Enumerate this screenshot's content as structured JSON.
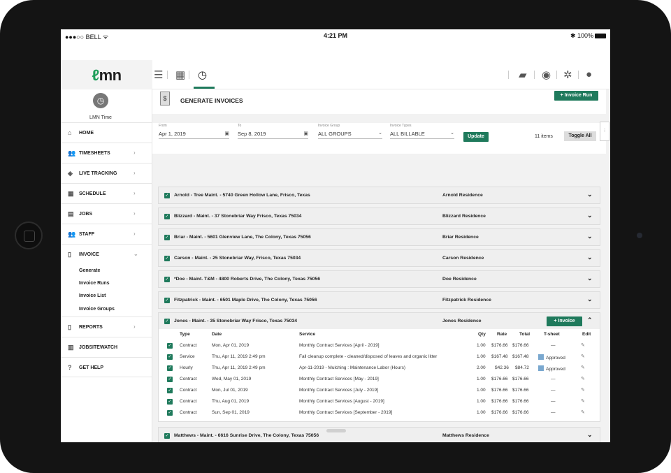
{
  "status_bar": {
    "carrier": "●●●○○ BELL ᯤ",
    "time": "4:21 PM",
    "battery": "✱ 100%"
  },
  "brand": {
    "logo_prefix": "ℓ",
    "logo_text": "mn",
    "accent": "#1f7a5c",
    "logo_accent": "#1e9e5a"
  },
  "topnav": {
    "icons": [
      "menu-icon",
      "calculator-icon",
      "clock-icon",
      "chat-icon",
      "globe-icon",
      "gear-icon",
      "user-icon"
    ]
  },
  "sidebar": {
    "title": "LMN Time",
    "items": [
      {
        "label": "HOME",
        "icon": "⌂",
        "chevron": ""
      },
      {
        "label": "TIMESHEETS",
        "icon": "👥",
        "chevron": "›"
      },
      {
        "label": "LIVE TRACKING",
        "icon": "◈",
        "chevron": "›"
      },
      {
        "label": "SCHEDULE",
        "icon": "▦",
        "chevron": "›"
      },
      {
        "label": "JOBS",
        "icon": "▤",
        "chevron": "›"
      },
      {
        "label": "STAFF",
        "icon": "👥",
        "chevron": "›"
      },
      {
        "label": "INVOICE",
        "icon": "▯",
        "chevron": "⌄"
      },
      {
        "label": "REPORTS",
        "icon": "▯",
        "chevron": "›"
      },
      {
        "label": "JOBSITEWATCH",
        "icon": "▥",
        "chevron": ""
      },
      {
        "label": "GET HELP",
        "icon": "?",
        "chevron": ""
      }
    ],
    "invoice_sub": [
      "Generate",
      "Invoice Runs",
      "Invoice List",
      "Invoice Groups"
    ]
  },
  "header": {
    "title": "GENERATE INVOICES",
    "run_button": "+ Invoice Run",
    "doc_icon": "$"
  },
  "filters": {
    "from_label": "From",
    "from_value": "Apr 1, 2019",
    "to_label": "To",
    "to_value": "Sep 8, 2019",
    "group_label": "Invoice Group",
    "group_value": "ALL GROUPS",
    "types_label": "Invoice Types",
    "types_value": "ALL BILLABLE",
    "update_button": "Update",
    "items_count": "11 items",
    "toggle_button": "Toggle All"
  },
  "invoice_rows": [
    {
      "address": "Arnold - Tree Maint. - 5740 Green Hollow Lane, Frisco, Texas",
      "name": "Arnold Residence"
    },
    {
      "address": "Blizzard - Maint. - 37 Stonebriar Way Frisco, Texas 75034",
      "name": "Blizzard Residence"
    },
    {
      "address": "Briar - Maint. - 5601 Glenview Lane, The Colony, Texas 75056",
      "name": "Briar Residence"
    },
    {
      "address": "Carson - Maint. - 25 Stonebriar Way, Frisco, Texas 75034",
      "name": "Carson Residence"
    },
    {
      "address": "*Doe - Maint. T&M - 4800 Roberts Drive, The Colony, Texas 75056",
      "name": "Doe Residence"
    },
    {
      "address": "Fitzpatrick - Maint. - 6501 Maple Drive, The Colony, Texas 75056",
      "name": "Fitzpatrick Residence"
    },
    {
      "address": "Jones - Maint. - 35 Stonebriar Way Frisco, Texas 75034",
      "name": "Jones Residence"
    },
    {
      "address": "Matthews - Maint. - 6616 Sunrise Drive, The Colony, Texas 75056",
      "name": "Matthews Residence"
    }
  ],
  "expanded": {
    "invoice_button": "+ Invoice",
    "columns": {
      "type": "Type",
      "date": "Date",
      "service": "Service",
      "qty": "Qty",
      "rate": "Rate",
      "total": "Total",
      "tsheet": "T-sheet",
      "edit": "Edit"
    },
    "lines": [
      {
        "type": "Contract",
        "date": "Mon, Apr 01, 2019",
        "service": "Monthly Contract Services [April - 2019]",
        "qty": "1.00",
        "rate": "$176.66",
        "total": "$176.66",
        "tsheet": "—"
      },
      {
        "type": "Service",
        "date": "Thu, Apr 11, 2019 2:49 pm",
        "service": "Fall cleanup complete - cleaned/disposed of leaves and organic litter",
        "qty": "1.00",
        "rate": "$167.48",
        "total": "$167.48",
        "tsheet": "Approved"
      },
      {
        "type": "Hourly",
        "date": "Thu, Apr 11, 2019 2:49 pm",
        "service": "Apr-11-2019 - Mulching : Maintenance Labor (Hours)",
        "qty": "2.00",
        "rate": "$42.36",
        "total": "$84.72",
        "tsheet": "Approved"
      },
      {
        "type": "Contract",
        "date": "Wed, May 01, 2019",
        "service": "Monthly Contract Services [May - 2019]",
        "qty": "1.00",
        "rate": "$176.66",
        "total": "$176.66",
        "tsheet": "—"
      },
      {
        "type": "Contract",
        "date": "Mon, Jul 01, 2019",
        "service": "Monthly Contract Services [July - 2019]",
        "qty": "1.00",
        "rate": "$176.66",
        "total": "$176.66",
        "tsheet": "—"
      },
      {
        "type": "Contract",
        "date": "Thu, Aug 01, 2019",
        "service": "Monthly Contract Services [August - 2019]",
        "qty": "1.00",
        "rate": "$176.66",
        "total": "$176.66",
        "tsheet": "—"
      },
      {
        "type": "Contract",
        "date": "Sun, Sep 01, 2019",
        "service": "Monthly Contract Services [September - 2019]",
        "qty": "1.00",
        "rate": "$176.66",
        "total": "$176.66",
        "tsheet": "—"
      }
    ]
  }
}
